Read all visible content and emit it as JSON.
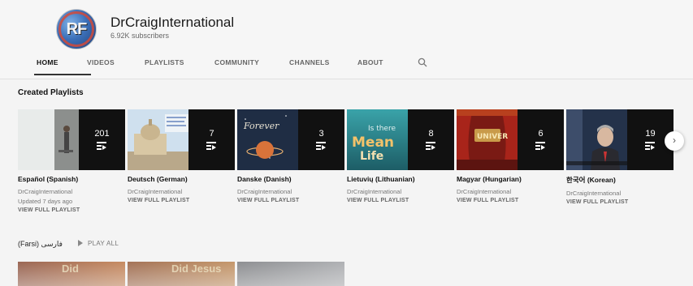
{
  "channel": {
    "name": "DrCraigInternational",
    "subscribers": "6.92K subscribers",
    "avatar_text": "RF"
  },
  "tabs": [
    {
      "label": "HOME",
      "active": true
    },
    {
      "label": "VIDEOS",
      "active": false
    },
    {
      "label": "PLAYLISTS",
      "active": false
    },
    {
      "label": "COMMUNITY",
      "active": false
    },
    {
      "label": "CHANNELS",
      "active": false
    },
    {
      "label": "ABOUT",
      "active": false
    }
  ],
  "icons": {
    "search": "search-icon",
    "next": "chevron-right-icon",
    "playlist": "playlist-icon",
    "play": "play-icon"
  },
  "section": {
    "title": "Created Playlists"
  },
  "playlists": [
    {
      "title": "Español (Spanish)",
      "owner": "DrCraigInternational",
      "updated": "Updated 7 days ago",
      "view": "VIEW FULL PLAYLIST",
      "count": "201"
    },
    {
      "title": "Deutsch (German)",
      "owner": "DrCraigInternational",
      "view": "VIEW FULL PLAYLIST",
      "count": "7"
    },
    {
      "title": "Danske (Danish)",
      "owner": "DrCraigInternational",
      "view": "VIEW FULL PLAYLIST",
      "count": "3",
      "thumb_text": "Forever"
    },
    {
      "title": "Lietuvių (Lithuanian)",
      "owner": "DrCraigInternational",
      "view": "VIEW FULL PLAYLIST",
      "count": "8",
      "thumb_text": "Is there Meaning Life?"
    },
    {
      "title": "Magyar (Hungarian)",
      "owner": "DrCraigInternational",
      "view": "VIEW FULL PLAYLIST",
      "count": "6",
      "thumb_text": "UNIVER"
    },
    {
      "title": "한국어 (Korean)",
      "owner": "DrCraigInternational",
      "view": "VIEW FULL PLAYLIST",
      "count": "19"
    }
  ],
  "row2": {
    "title": "فارسی (Farsi)",
    "play_all": "PLAY ALL",
    "thumbs": [
      {
        "text": "Did"
      },
      {
        "text": "Did Jesus"
      }
    ]
  },
  "colors": {
    "background": "#f4f4f4",
    "overlay": "#0a0a0a",
    "tab_underline": "#333333"
  }
}
